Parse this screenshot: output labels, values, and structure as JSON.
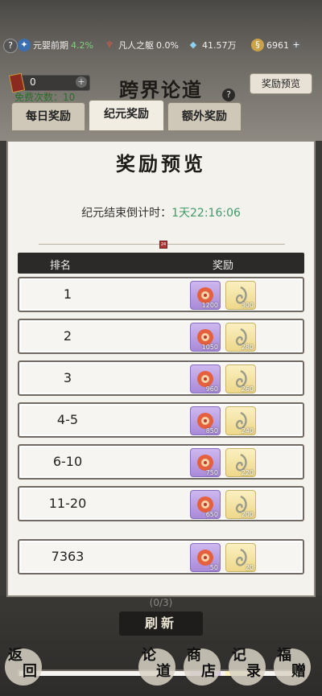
{
  "status_bar": {
    "help": "?",
    "realm": "元婴前期",
    "realm_percent": "4.2%",
    "body": "凡人之躯",
    "body_percent": "0.0%",
    "spirit_stones": "41.57万",
    "gold": "6961",
    "plus": "+"
  },
  "header": {
    "resource_count": "0",
    "resource_plus": "+",
    "title": "跨界论道",
    "reward_preview_button": "奖励预览",
    "help": "?",
    "free_times": "免费次数：10"
  },
  "tabs": [
    {
      "label": "每日奖励",
      "active": false
    },
    {
      "label": "纪元奖励",
      "active": true
    },
    {
      "label": "额外奖励",
      "active": false
    }
  ],
  "modal": {
    "title": "奖励预览",
    "countdown_label": "纪元结束倒计时：",
    "countdown_time": "1天22:16:06",
    "divider_mark": "24",
    "col_rank": "排名",
    "col_reward": "奖励",
    "rows": [
      {
        "rank": "1",
        "reward1": "1200",
        "reward2": "300"
      },
      {
        "rank": "2",
        "reward1": "1050",
        "reward2": "280"
      },
      {
        "rank": "3",
        "reward1": "960",
        "reward2": "260"
      },
      {
        "rank": "4-5",
        "reward1": "850",
        "reward2": "240"
      },
      {
        "rank": "6-10",
        "reward1": "750",
        "reward2": "220"
      },
      {
        "rank": "11-20",
        "reward1": "650",
        "reward2": "200"
      }
    ],
    "self_row": {
      "rank": "7363",
      "reward1": "50",
      "reward2": "20"
    }
  },
  "bottom": {
    "pager": "(0/3)",
    "refresh": "刷新",
    "nav": [
      {
        "c1": "返",
        "c2": "回"
      },
      {
        "c1": "论",
        "c2": "道"
      },
      {
        "c1": "商",
        "c2": "店"
      },
      {
        "c1": "记",
        "c2": "录"
      },
      {
        "c1": "福",
        "c2": "赠"
      }
    ]
  }
}
